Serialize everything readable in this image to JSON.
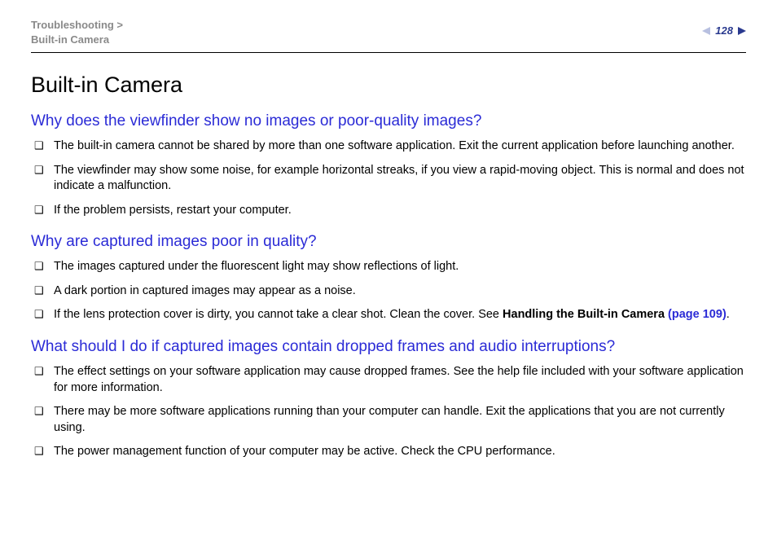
{
  "header": {
    "breadcrumb_line1": "Troubleshooting >",
    "breadcrumb_line2": "Built-in Camera",
    "page_number": "128"
  },
  "title": "Built-in Camera",
  "sections": [
    {
      "question": "Why does the viewfinder show no images or poor-quality images?",
      "items": [
        {
          "text": "The built-in camera cannot be shared by more than one software application. Exit the current application before launching another."
        },
        {
          "text": "The viewfinder may show some noise, for example horizontal streaks, if you view a rapid-moving object. This is normal and does not indicate a malfunction."
        },
        {
          "text": "If the problem persists, restart your computer."
        }
      ]
    },
    {
      "question": "Why are captured images poor in quality?",
      "items": [
        {
          "text": "The images captured under the fluorescent light may show reflections of light."
        },
        {
          "text": "A dark portion in captured images may appear as a noise."
        },
        {
          "text": "If the lens protection cover is dirty, you cannot take a clear shot. Clean the cover. See ",
          "ref_bold": "Handling the Built-in Camera ",
          "ref_link": "(page 109)",
          "trail": "."
        }
      ]
    },
    {
      "question": "What should I do if captured images contain dropped frames and audio interruptions?",
      "items": [
        {
          "text": "The effect settings on your software application may cause dropped frames. See the help file included with your software application for more information."
        },
        {
          "text": "There may be more software applications running than your computer can handle. Exit the applications that you are not currently using."
        },
        {
          "text": "The power management function of your computer may be active. Check the CPU performance."
        }
      ]
    }
  ]
}
